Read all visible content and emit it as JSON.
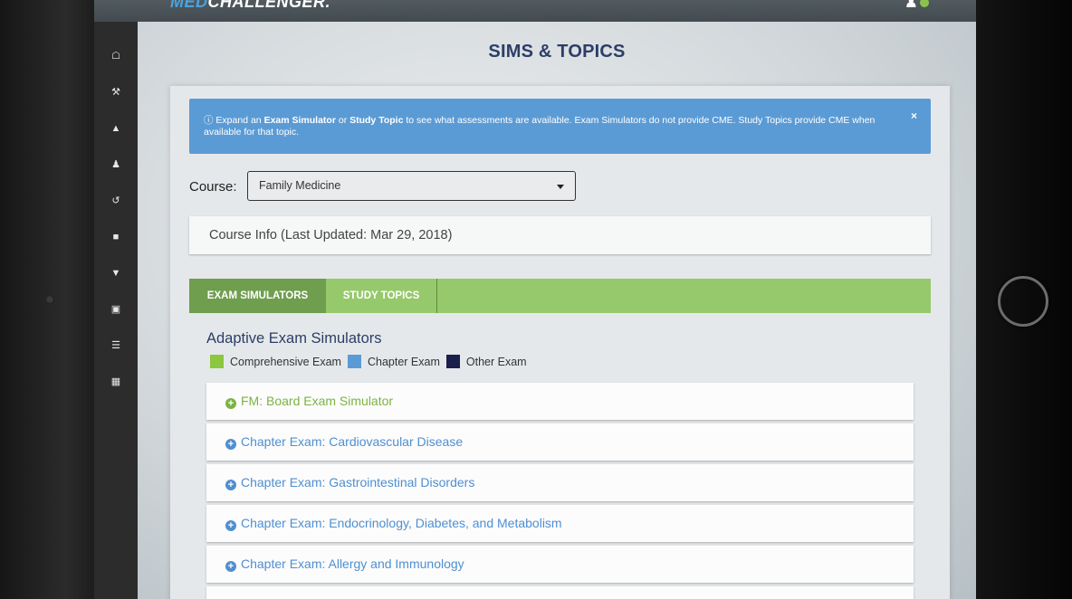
{
  "topbar": {
    "brand_pre": "MED",
    "brand_main": "CHALLENGER."
  },
  "page_title": "SIMS & TOPICS",
  "nav_icons": [
    "home-icon",
    "wrench-icon",
    "graduation-cap-icon",
    "user-md-icon",
    "history-icon",
    "book-icon",
    "trophy-icon",
    "id-card-icon",
    "cart-icon",
    "ambulance-icon"
  ],
  "alert": {
    "pre": "Expand an ",
    "b1": "Exam Simulator",
    "mid": " or ",
    "b2": "Study Topic",
    "post": " to see what assessments are available. Exam Simulators do not provide CME. Study Topics provide CME when available for that topic.",
    "close": "×"
  },
  "course": {
    "label": "Course:",
    "selected": "Family Medicine"
  },
  "course_info": "Course Info (Last Updated: Mar 29, 2018)",
  "tabs": {
    "exam_simulators": "EXAM SIMULATORS",
    "study_topics": "STUDY TOPICS"
  },
  "simulators": {
    "heading": "Adaptive Exam Simulators",
    "legend": [
      {
        "label": "Comprehensive Exam",
        "color": "#8dc63f"
      },
      {
        "label": "Chapter Exam",
        "color": "#5b9bd5"
      },
      {
        "label": "Other Exam",
        "color": "#1b1f4b"
      }
    ],
    "items": [
      {
        "title": "FM: Board Exam Simulator",
        "color": "#7cb342"
      },
      {
        "title": "Chapter Exam: Cardiovascular Disease",
        "color": "#4f8fd0"
      },
      {
        "title": "Chapter Exam: Gastrointestinal Disorders",
        "color": "#4f8fd0"
      },
      {
        "title": "Chapter Exam: Endocrinology, Diabetes, and Metabolism",
        "color": "#4f8fd0"
      },
      {
        "title": "Chapter Exam: Allergy and Immunology",
        "color": "#4f8fd0"
      }
    ]
  }
}
